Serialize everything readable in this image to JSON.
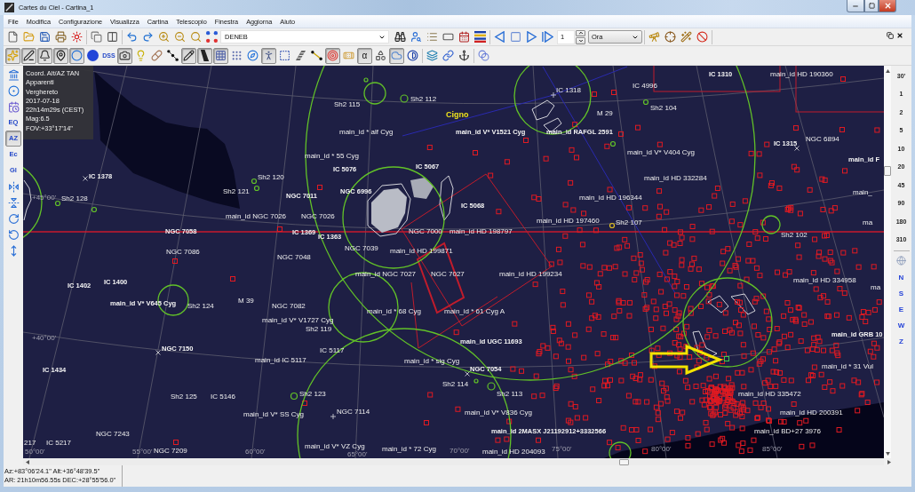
{
  "window": {
    "title": "Cartes du Ciel - Cartina_1"
  },
  "menu": [
    "File",
    "Modifica",
    "Configurazione",
    "Visualizza",
    "Cartina",
    "Telescopio",
    "Finestra",
    "Aggiorna",
    "Aiuto"
  ],
  "main_toolbar": {
    "object": "DENEB",
    "step": "1",
    "unit": "Ora"
  },
  "display_toolbar": {
    "buttons": [
      {
        "on": true
      },
      {
        "on": true
      },
      {
        "on": true
      },
      {
        "on": true
      },
      {
        "on": true
      },
      {
        "on": false
      },
      {
        "label": "DSS",
        "on": false
      },
      {
        "on": true
      },
      {
        "on": false
      },
      {
        "on": false
      },
      {
        "on": false
      },
      {
        "on": true
      },
      {
        "on": true
      },
      {
        "on": true
      },
      {
        "on": false
      },
      {
        "on": false
      },
      {
        "on": true
      },
      {
        "on": false
      },
      {
        "on": false
      },
      {
        "on": false
      },
      {
        "on": true
      },
      {
        "on": false
      },
      {
        "label": "α",
        "on": true
      },
      {
        "on": false
      },
      {
        "on": true
      },
      {
        "on": false
      },
      {
        "on": false
      },
      {
        "on": false
      },
      {
        "on": false
      },
      {
        "on": false
      }
    ]
  },
  "side_toolbar": {
    "buttons": [
      {
        "on": false
      },
      {
        "on": false
      },
      {
        "on": false
      },
      {
        "label": "EQ",
        "on": false
      },
      {
        "label": "AZ",
        "on": true
      },
      {
        "label": "Ec",
        "on": false
      },
      {
        "label": "Gl",
        "on": false
      },
      {
        "on": false
      },
      {
        "on": false
      },
      {
        "on": false
      },
      {
        "on": false
      },
      {
        "on": false
      }
    ]
  },
  "chart_info": [
    "Coord. Alt/AZ TAN",
    "Apparenti",
    "Verghereto",
    "2017-07-18",
    "22h14m29s (CEST)",
    "Mag:6.5",
    "FOV:+33°17'14\""
  ],
  "sky_chart": {
    "labels": [
      {
        "text": "IC 1310",
        "kind": "small"
      },
      {
        "text": "main_id HD 190360",
        "kind": "object"
      },
      {
        "text": "IC 1318",
        "kind": "object"
      },
      {
        "text": "IC 4996",
        "kind": "object"
      },
      {
        "text": "Sh2 115",
        "kind": "object"
      },
      {
        "text": "Sh2 112",
        "kind": "object"
      },
      {
        "text": "Cigno",
        "kind": "constellation"
      },
      {
        "text": "M 29",
        "kind": "object"
      },
      {
        "text": "Sh2 104",
        "kind": "object"
      },
      {
        "text": "main_id * alf Cyg",
        "kind": "object"
      },
      {
        "text": "main_id V* V1521 Cyg",
        "kind": "small"
      },
      {
        "text": "main_id RAFGL 2591",
        "kind": "small"
      },
      {
        "text": "IC 1315",
        "kind": "small"
      },
      {
        "text": "NGC 6894",
        "kind": "object"
      },
      {
        "text": "main_id * 55 Cyg",
        "kind": "object"
      },
      {
        "text": "main_id V* V404 Cyg",
        "kind": "object"
      },
      {
        "text": "main_id F",
        "kind": "small"
      },
      {
        "text": "IC 5076",
        "kind": "small"
      },
      {
        "text": "IC 5067",
        "kind": "small"
      },
      {
        "text": "IC 1378",
        "kind": "small"
      },
      {
        "text": "Sh2 120",
        "kind": "object"
      },
      {
        "text": "main_id HD 332284",
        "kind": "object"
      },
      {
        "text": "+45°00'",
        "kind": "grid"
      },
      {
        "text": "Sh2 128",
        "kind": "object"
      },
      {
        "text": "Sh2 121",
        "kind": "object"
      },
      {
        "text": "NGC 7011",
        "kind": "small"
      },
      {
        "text": "NGC 6996",
        "kind": "small"
      },
      {
        "text": "main_id HD 196344",
        "kind": "object"
      },
      {
        "text": "main_",
        "kind": "object"
      },
      {
        "text": "IC 5068",
        "kind": "small"
      },
      {
        "text": "main_id NGC 7026",
        "kind": "object"
      },
      {
        "text": "NGC 7026",
        "kind": "object"
      },
      {
        "text": "main_id HD 197460",
        "kind": "object"
      },
      {
        "text": "Sh2 107",
        "kind": "object"
      },
      {
        "text": "ma",
        "kind": "object"
      },
      {
        "text": "NGC 7058",
        "kind": "small"
      },
      {
        "text": "IC 1369",
        "kind": "small"
      },
      {
        "text": "IC 1363",
        "kind": "small"
      },
      {
        "text": "NGC 7000",
        "kind": "object"
      },
      {
        "text": "main_id HD 198797",
        "kind": "object"
      },
      {
        "text": "Sh2 102",
        "kind": "object"
      },
      {
        "text": "NGC 7086",
        "kind": "object"
      },
      {
        "text": "NGC 7039",
        "kind": "object"
      },
      {
        "text": "NGC 7048",
        "kind": "object"
      },
      {
        "text": "main_id HD 199871",
        "kind": "object"
      },
      {
        "text": "main_id NGC 7027",
        "kind": "object"
      },
      {
        "text": "NGC 7027",
        "kind": "object"
      },
      {
        "text": "main_id HD 199234",
        "kind": "object"
      },
      {
        "text": "IC 1402",
        "kind": "small"
      },
      {
        "text": "IC 1400",
        "kind": "small"
      },
      {
        "text": "main_id HD 334958",
        "kind": "object"
      },
      {
        "text": "ma",
        "kind": "object"
      },
      {
        "text": "main_id V* V645 Cyg",
        "kind": "small"
      },
      {
        "text": "Sh2 124",
        "kind": "object"
      },
      {
        "text": "M 39",
        "kind": "object"
      },
      {
        "text": "NGC 7082",
        "kind": "object"
      },
      {
        "text": "main_id * 68 Cyg",
        "kind": "object"
      },
      {
        "text": "main_id * 61 Cyg A",
        "kind": "object"
      },
      {
        "text": "main_id V* V1727 Cyg",
        "kind": "object"
      },
      {
        "text": "Sh2 119",
        "kind": "object"
      },
      {
        "text": "+40°00'",
        "kind": "grid"
      },
      {
        "text": "main_id GRB 10",
        "kind": "small"
      },
      {
        "text": "main_id UGC 11693",
        "kind": "small"
      },
      {
        "text": "NGC 7150",
        "kind": "small"
      },
      {
        "text": "IC 5117",
        "kind": "object"
      },
      {
        "text": "main_id IC 5117",
        "kind": "object"
      },
      {
        "text": "main_id * sig Cyg",
        "kind": "object"
      },
      {
        "text": "IC 1434",
        "kind": "small"
      },
      {
        "text": "NGC 7054",
        "kind": "small"
      },
      {
        "text": "main_id * 31 Vul",
        "kind": "object"
      },
      {
        "text": "Sh2 114",
        "kind": "object"
      },
      {
        "text": "Sh2 125",
        "kind": "object"
      },
      {
        "text": "IC 5146",
        "kind": "object"
      },
      {
        "text": "Sh2 123",
        "kind": "object"
      },
      {
        "text": "Sh2 113",
        "kind": "object"
      },
      {
        "text": "main_id HD 335472",
        "kind": "object"
      },
      {
        "text": "main_id V* SS Cyg",
        "kind": "object"
      },
      {
        "text": "NGC 7114",
        "kind": "object"
      },
      {
        "text": "main_id V* V836 Cyg",
        "kind": "object"
      },
      {
        "text": "main_id HD 200391",
        "kind": "object"
      },
      {
        "text": "NGC 7243",
        "kind": "object"
      },
      {
        "text": "main_id 2MASX J21192912+3332566",
        "kind": "small"
      },
      {
        "text": "main_id BD+27 3976",
        "kind": "object"
      },
      {
        "text": "217",
        "kind": "object"
      },
      {
        "text": "IC 5217",
        "kind": "object"
      },
      {
        "text": "50°00'",
        "kind": "grid"
      },
      {
        "text": "55°00'",
        "kind": "grid"
      },
      {
        "text": "NGC 7209",
        "kind": "object"
      },
      {
        "text": "60°00'",
        "kind": "grid"
      },
      {
        "text": "main_id V* VZ Cyg",
        "kind": "object"
      },
      {
        "text": "65°00'",
        "kind": "grid"
      },
      {
        "text": "main_id * 72 Cyg",
        "kind": "object"
      },
      {
        "text": "70°00'",
        "kind": "grid"
      },
      {
        "text": "main_id HD 204093",
        "kind": "object"
      },
      {
        "text": "75°00'",
        "kind": "grid"
      },
      {
        "text": "80°00'",
        "kind": "grid"
      },
      {
        "text": "85°00'",
        "kind": "grid"
      }
    ]
  },
  "zoom_panel": {
    "levels": [
      "30'",
      "1",
      "2",
      "5",
      "10",
      "20",
      "45",
      "90",
      "180",
      "310"
    ],
    "directions": [
      "N",
      "S",
      "E",
      "W",
      "Z"
    ]
  },
  "status_bar": {
    "lines": [
      "Az:+83°06'24.1\" Alt:+36°48'39.5\"",
      "AR: 21h10m56.55s DEC:+28°55'56.0\""
    ]
  }
}
